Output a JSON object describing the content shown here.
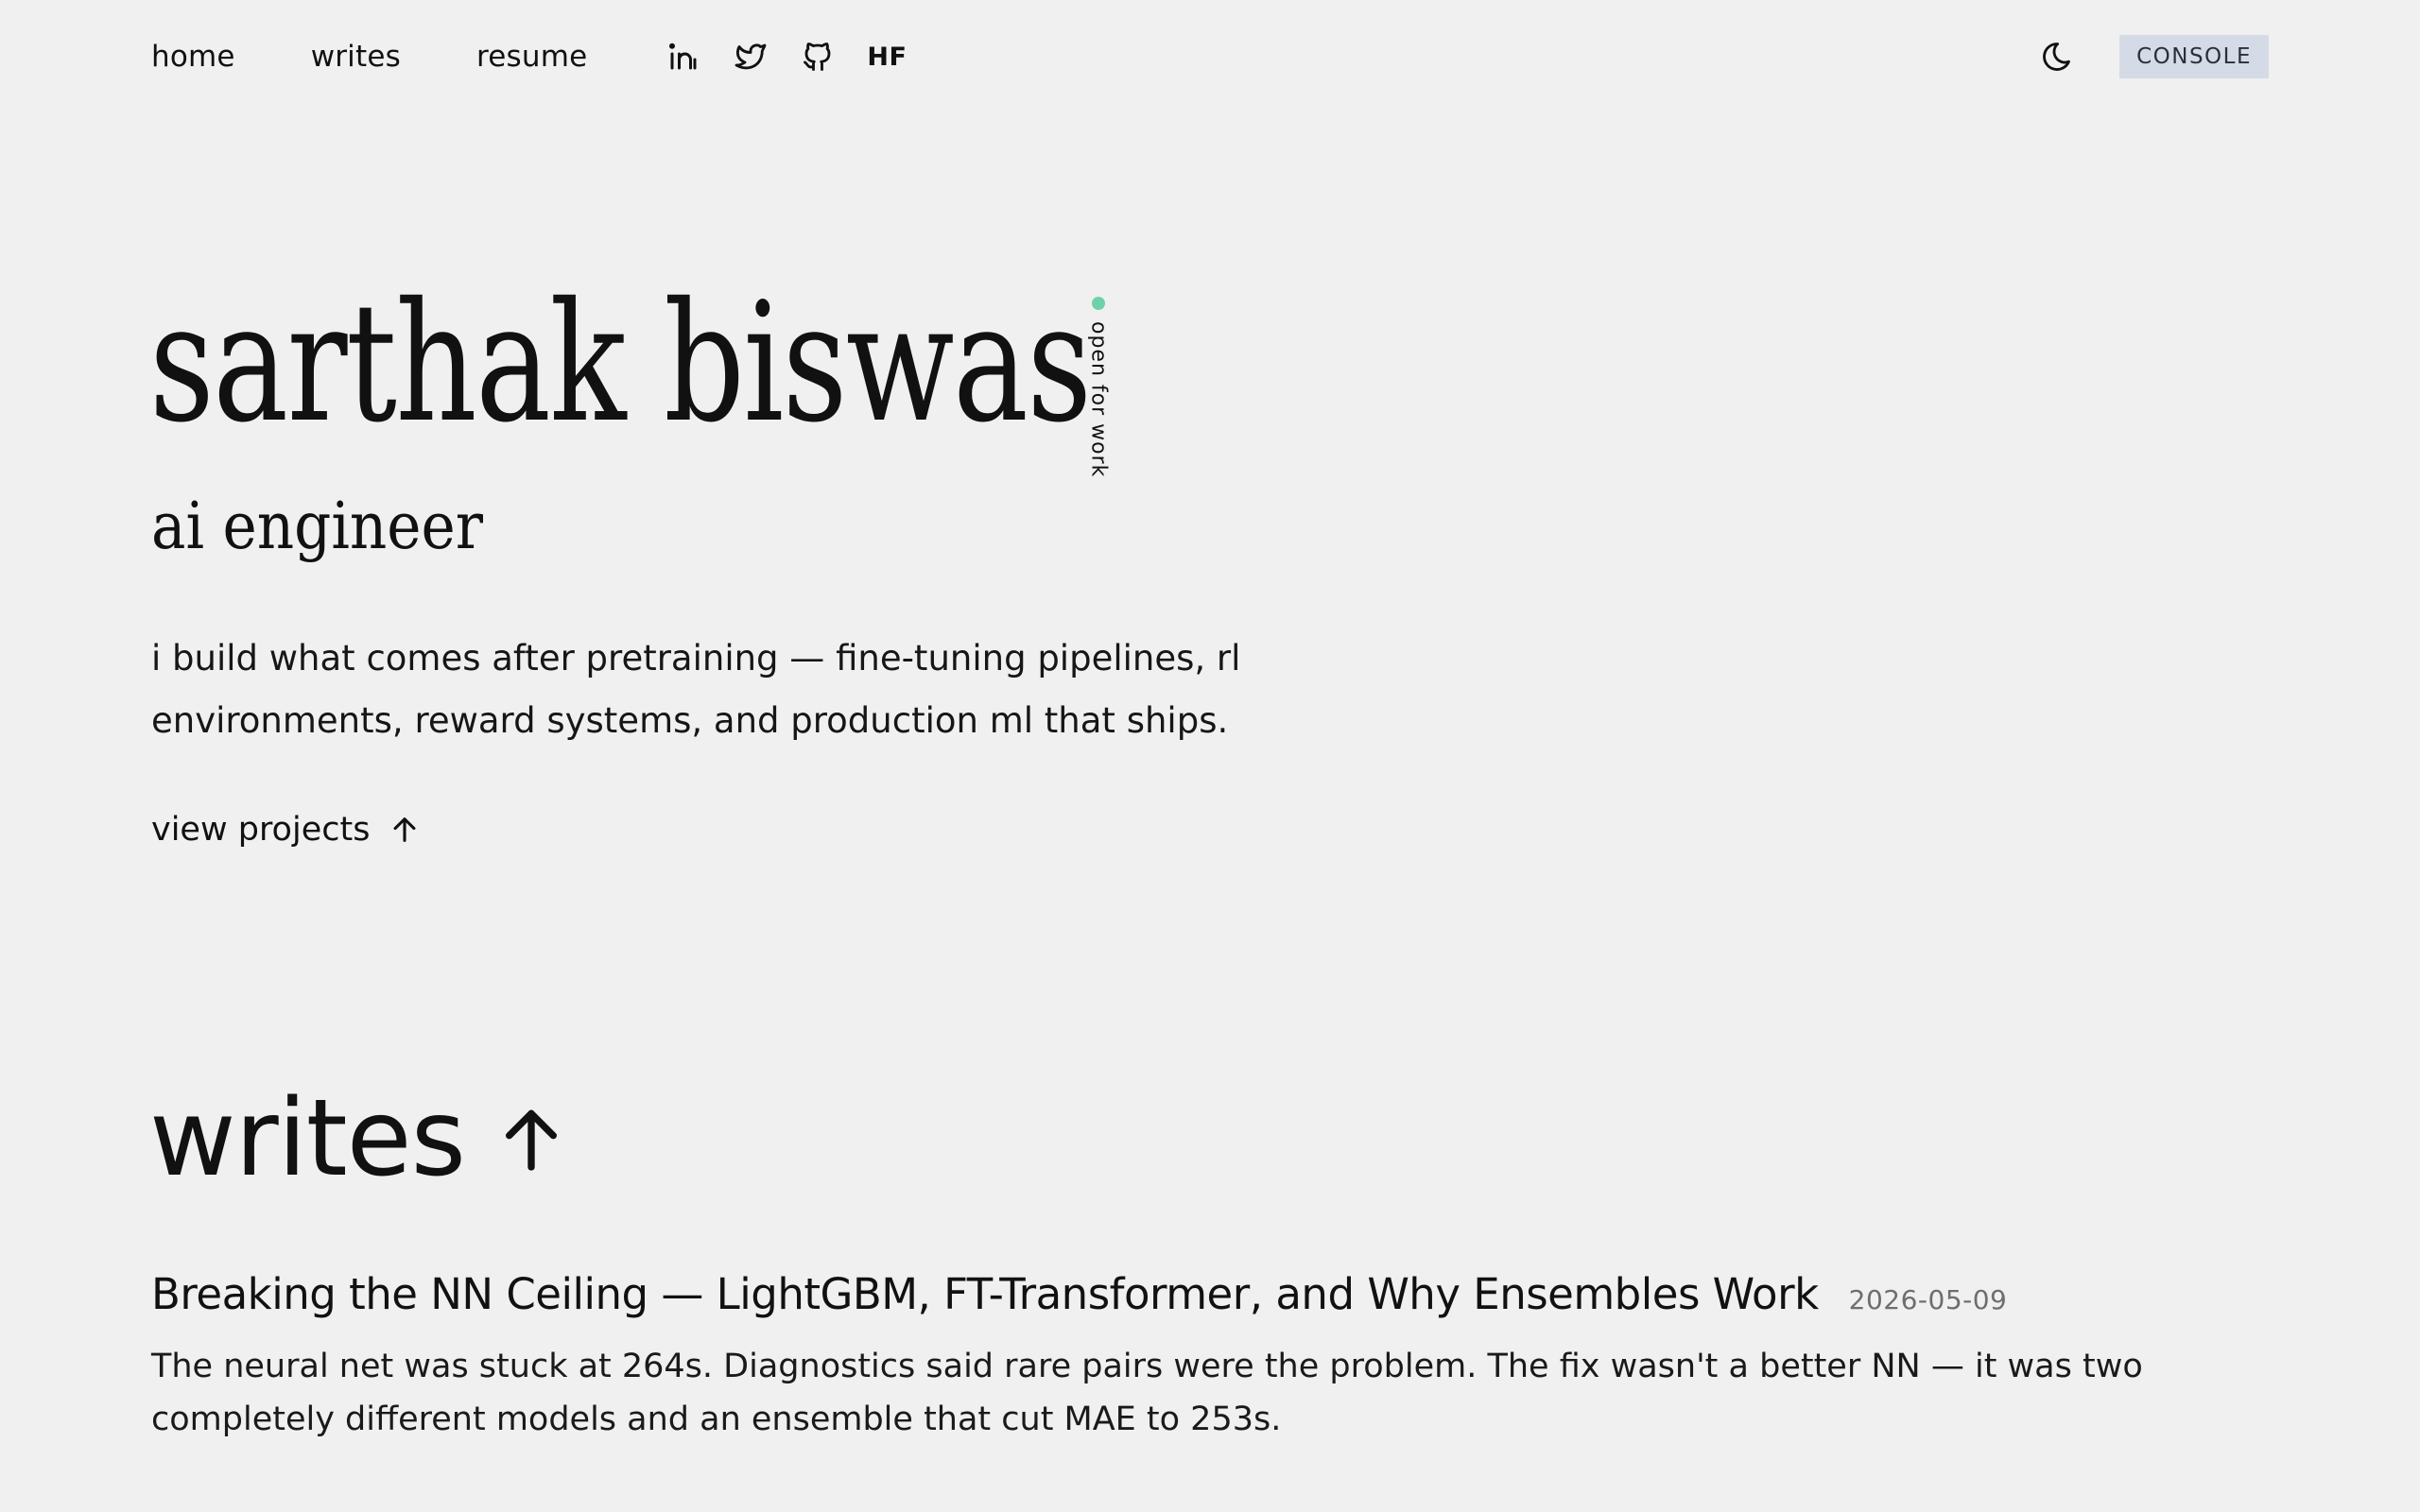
{
  "nav": {
    "links": {
      "home": "home",
      "writes": "writes",
      "resume": "resume"
    },
    "social": {
      "linkedin_icon": "linkedin-icon",
      "twitter_icon": "twitter-icon",
      "github_icon": "github-icon",
      "hf_label": "HF"
    },
    "theme_icon": "moon-icon",
    "console_label": "CONSOLE"
  },
  "hero": {
    "name": "sarthak biswas",
    "status": "open for work",
    "status_color": "#6fd1a9",
    "role": "ai engineer",
    "description": "i build what comes after pretraining — fine-tuning pipelines, rl environments, reward systems, and production ml that ships.",
    "cta_label": "view projects"
  },
  "writes": {
    "heading": "writes",
    "posts": [
      {
        "title": "Breaking the NN Ceiling — LightGBM, FT-Transformer, and Why Ensembles Work",
        "date": "2026-05-09",
        "excerpt": "The neural net was stuck at 264s. Diagnostics said rare pairs were the problem. The fix wasn't a better NN — it was two completely different models and an ensemble that cut MAE to 253s."
      }
    ]
  },
  "colors": {
    "background": "#f0f0f0",
    "text": "#111111",
    "console_bg": "#d5dbe6",
    "date": "#6e6e6e"
  }
}
